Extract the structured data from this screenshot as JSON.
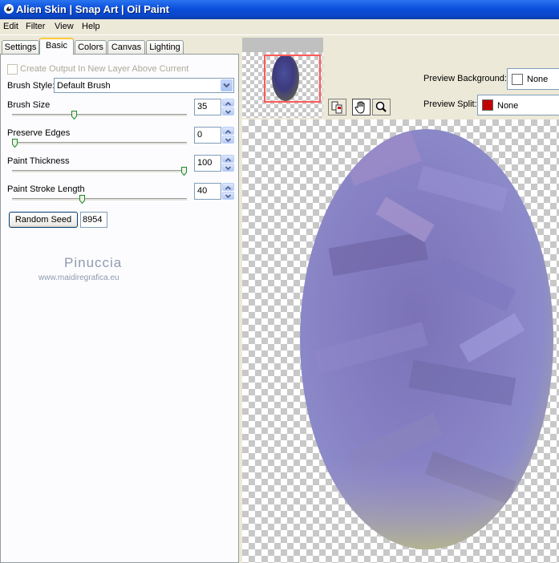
{
  "window": {
    "title": "Alien Skin | Snap Art | Oil Paint"
  },
  "menu": [
    "Edit",
    "Filter",
    "View",
    "Help"
  ],
  "tabs": [
    "Settings",
    "Basic",
    "Colors",
    "Canvas",
    "Lighting"
  ],
  "basic": {
    "create_output_label": "Create Output In New Layer Above Current",
    "brush_style_label": "Brush Style:",
    "brush_style_value": "Default Brush",
    "brush_size_label": "Brush Size",
    "brush_size_value": "35",
    "brush_size_level": 0.35,
    "preserve_edges_label": "Preserve Edges",
    "preserve_edges_value": "0",
    "preserve_edges_level": 0.0,
    "paint_thickness_label": "Paint Thickness",
    "paint_thickness_value": "100",
    "paint_thickness_level": 1.0,
    "paint_stroke_length_label": "Paint Stroke Length",
    "paint_stroke_length_value": "40",
    "paint_stroke_length_level": 0.4,
    "random_seed_label": "Random Seed",
    "random_seed_value": "8954"
  },
  "watermark": {
    "name": "Pinuccia",
    "url": "www.maidiregrafica.eu"
  },
  "preview": {
    "background_label": "Preview Background:",
    "background_value": "None",
    "split_label": "Preview Split:",
    "split_value": "None",
    "split_color": "#c00000"
  },
  "colors": {
    "accent": "#ffc83c",
    "titlebar": "#0b4fdc"
  }
}
